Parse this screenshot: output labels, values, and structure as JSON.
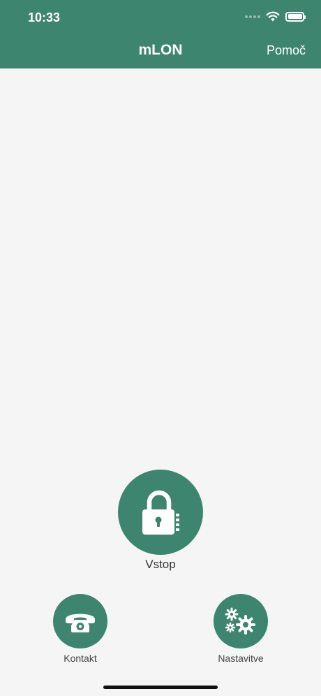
{
  "status_bar": {
    "time": "10:33"
  },
  "header": {
    "title": "mLON",
    "help_label": "Pomoč"
  },
  "main_action": {
    "label": "Vstop",
    "icon": "padlock-icon"
  },
  "bottom_actions": [
    {
      "label": "Kontakt",
      "icon": "telephone-icon"
    },
    {
      "label": "Nastavitve",
      "icon": "gears-icon"
    }
  ],
  "colors": {
    "primary": "#3e8570",
    "background": "#f5f5f5"
  }
}
